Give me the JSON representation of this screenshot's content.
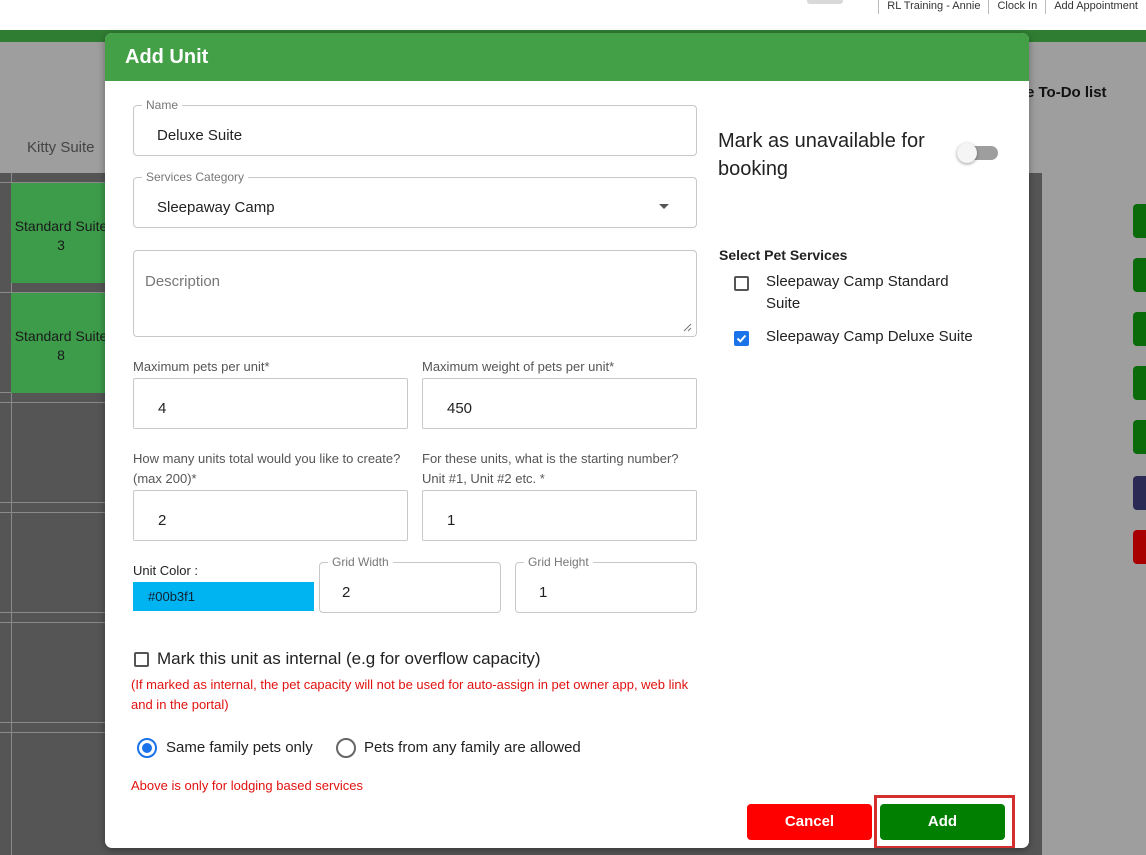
{
  "topnav": {
    "items": [
      "RL Training - Annie",
      "Clock In",
      "Add Appointment"
    ]
  },
  "background": {
    "todo_label": "e To-Do list",
    "column_label": "Kitty Suite",
    "cells": [
      {
        "label": "Standard Suite",
        "num": "3"
      },
      {
        "label": "Standard Suite",
        "num": "8"
      }
    ]
  },
  "modal": {
    "title": "Add Unit",
    "name": {
      "legend": "Name",
      "value": "Deluxe Suite"
    },
    "services_category": {
      "legend": "Services Category",
      "value": "Sleepaway Camp"
    },
    "description": {
      "placeholder": "Description"
    },
    "max_pets": {
      "label": "Maximum pets per unit*",
      "value": "4"
    },
    "max_weight": {
      "label": "Maximum weight of pets per unit*",
      "value": "450"
    },
    "units_total": {
      "label_line1": "How many units total would you like to create?",
      "label_line2": "(max 200)*",
      "value": "2"
    },
    "start_number": {
      "label_line1": "For these units, what is the starting number?",
      "label_line2": "Unit #1, Unit #2 etc. *",
      "value": "1"
    },
    "unit_color": {
      "label": "Unit Color :",
      "value": "#00b3f1"
    },
    "grid_width": {
      "legend": "Grid Width",
      "value": "2"
    },
    "grid_height": {
      "legend": "Grid Height",
      "value": "1"
    },
    "internal": {
      "label": "Mark this unit as internal (e.g for overflow capacity)",
      "checked": false,
      "warning": "(If marked as internal, the pet capacity will not be used for auto-assign in pet owner app, web link and in the portal)"
    },
    "family_options": [
      {
        "label": "Same family pets only",
        "selected": true
      },
      {
        "label": "Pets from any family are allowed",
        "selected": false
      }
    ],
    "lodging_note": "Above is only for lodging based services",
    "unavailable": {
      "label": "Mark as unavailable for booking",
      "on": false
    },
    "pet_services": {
      "heading": "Select Pet Services",
      "items": [
        {
          "label": "Sleepaway Camp Standard Suite",
          "checked": false
        },
        {
          "label": "Sleepaway Camp Deluxe Suite",
          "checked": true
        }
      ]
    },
    "buttons": {
      "cancel": "Cancel",
      "add": "Add"
    }
  },
  "colors": {
    "header_green": "#43a047",
    "add_green": "#007f00",
    "cancel_red": "#fe0000",
    "checkbox_blue": "#1a73e8",
    "warning_red": "#e0120f"
  }
}
